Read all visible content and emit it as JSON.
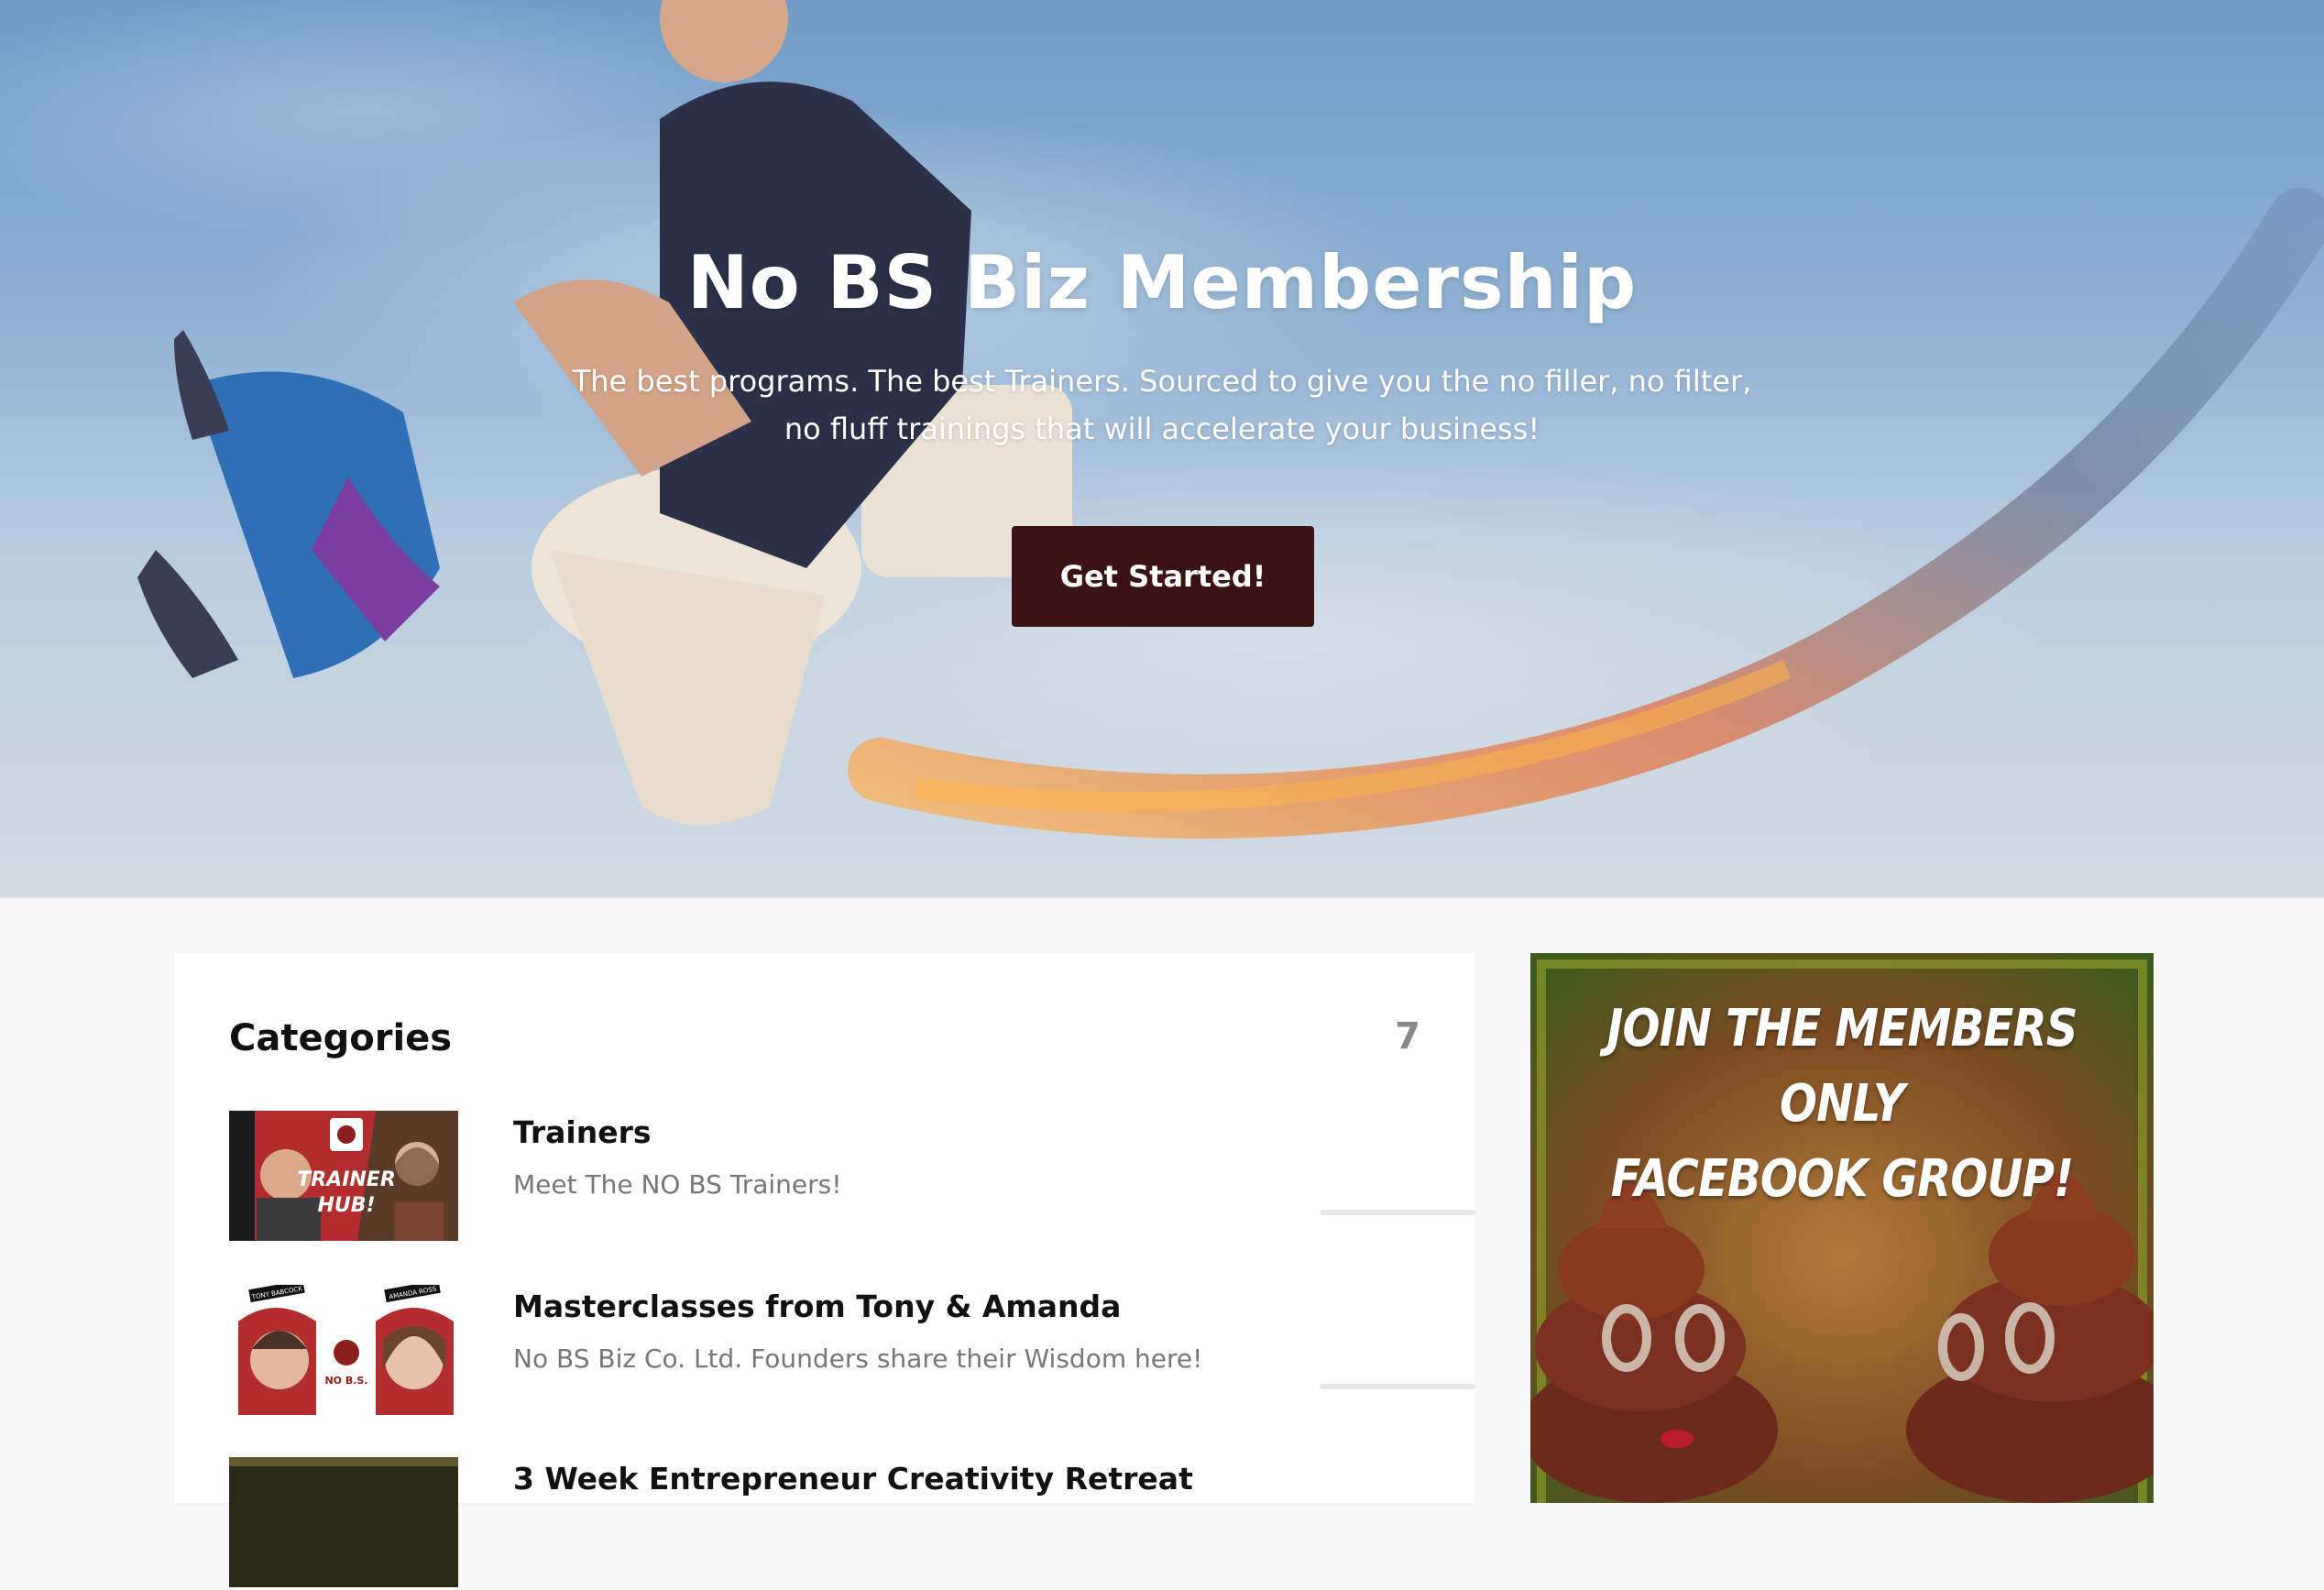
{
  "hero": {
    "title": "No BS Biz Membership",
    "subtitle": "The best programs. The best Trainers. Sourced to give you the no filler, no filter, no fluff trainings that will accelerate your business!",
    "cta_label": "Get Started!",
    "cta_color": "#3a1313"
  },
  "categories": {
    "title": "Categories",
    "count": "7",
    "items": [
      {
        "name": "Trainers",
        "description": "Meet The NO BS Trainers!",
        "thumb_text_1": "TRAINER",
        "thumb_text_2": "HUB!"
      },
      {
        "name": "Masterclasses from Tony & Amanda",
        "description": "No BS Biz Co. Ltd. Founders share their Wisdom here!",
        "thumb_label_left": "TONY BABCOCK",
        "thumb_label_right": "AMANDA ROSS"
      },
      {
        "name": "3 Week Entrepreneur Creativity Retreat",
        "description": ""
      }
    ]
  },
  "promo": {
    "text": "JOIN THE MEMBERS ONLY\nFACEBOOK GROUP!"
  }
}
